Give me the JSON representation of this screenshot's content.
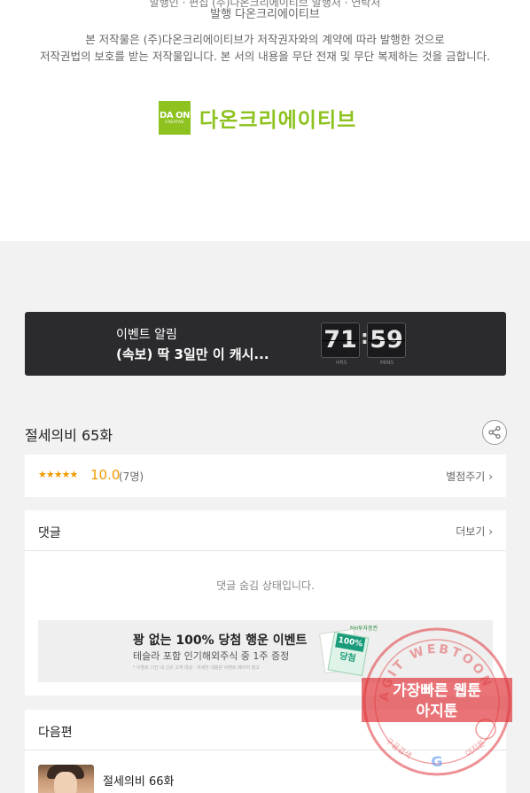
{
  "footer": {
    "partial_line": "발행인 · 편집  (주)다온크리에이티브  발행처 · 연락처",
    "publisher": "발행 다온크리에이티브",
    "copyright_line1": "본 저작물은 (주)다온크리에이티브가 저작권자와의 계약에 따라 발행한 것으로",
    "copyright_line2": "저작권법의 보호를 받는 저작물입니다. 본 서의 내용을 무단 전재 및 무단 복제하는 것을 금합니다.",
    "logo_box_top": "DA ON",
    "logo_box_bottom": "CREATIVE",
    "logo_text": "다온크리에이티브"
  },
  "event": {
    "label": "이벤트 알림",
    "headline": "(속보) 딱 3일만 이 캐시...",
    "hours": "71",
    "minutes": "59",
    "hours_label": "HRS",
    "minutes_label": "MINS"
  },
  "episode": {
    "title": "절세의비 65화",
    "stars": "★★★★★",
    "score": "10.0",
    "count": "(7명)",
    "rate_button": "별점주기"
  },
  "comments": {
    "title": "댓글",
    "more": "더보기",
    "hidden_message": "댓글 숨김 상태입니다.",
    "ad": {
      "line1": "꽝 없는 100% 당첨 행운 이벤트",
      "line2": "테슬라 포함 인기해외주식 중 1주 증정",
      "line3": "* 이벤트 기간 내 신규 고객 대상 · 자세한 내용은 이벤트 페이지 참고",
      "brand": "NH투자증권",
      "card_top": "100%",
      "card_bottom": "당첨"
    }
  },
  "next": {
    "title": "다음편",
    "episode_title": "절세의비 66화"
  },
  "watermark": {
    "ring_text": "AGIT WEBTOON",
    "line1": "가장빠른 웹툰",
    "line2": "아지툰",
    "bottom_left": "구글검색",
    "bottom_right": "아지툰"
  },
  "colors": {
    "brand_green": "#8dc21f",
    "star_orange": "#f39800",
    "event_bg": "#2b2a2d",
    "watermark_red": "#e0373c"
  }
}
